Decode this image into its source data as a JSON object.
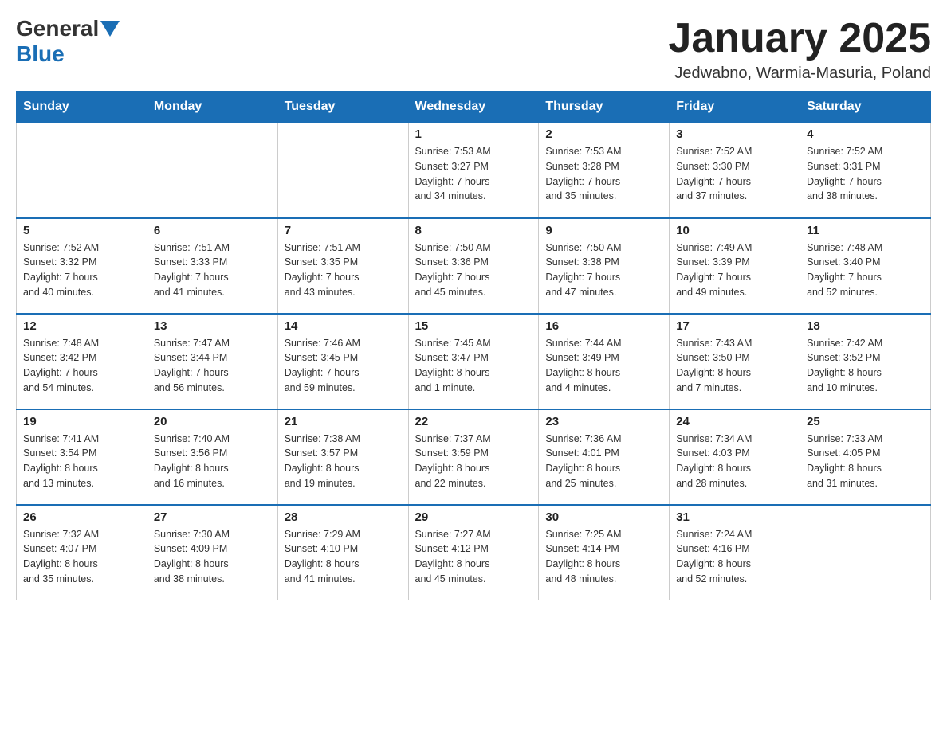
{
  "header": {
    "logo_general": "General",
    "logo_blue": "Blue",
    "month_year": "January 2025",
    "location": "Jedwabno, Warmia-Masuria, Poland"
  },
  "days_of_week": [
    "Sunday",
    "Monday",
    "Tuesday",
    "Wednesday",
    "Thursday",
    "Friday",
    "Saturday"
  ],
  "weeks": [
    [
      {
        "day": "",
        "info": ""
      },
      {
        "day": "",
        "info": ""
      },
      {
        "day": "",
        "info": ""
      },
      {
        "day": "1",
        "info": "Sunrise: 7:53 AM\nSunset: 3:27 PM\nDaylight: 7 hours\nand 34 minutes."
      },
      {
        "day": "2",
        "info": "Sunrise: 7:53 AM\nSunset: 3:28 PM\nDaylight: 7 hours\nand 35 minutes."
      },
      {
        "day": "3",
        "info": "Sunrise: 7:52 AM\nSunset: 3:30 PM\nDaylight: 7 hours\nand 37 minutes."
      },
      {
        "day": "4",
        "info": "Sunrise: 7:52 AM\nSunset: 3:31 PM\nDaylight: 7 hours\nand 38 minutes."
      }
    ],
    [
      {
        "day": "5",
        "info": "Sunrise: 7:52 AM\nSunset: 3:32 PM\nDaylight: 7 hours\nand 40 minutes."
      },
      {
        "day": "6",
        "info": "Sunrise: 7:51 AM\nSunset: 3:33 PM\nDaylight: 7 hours\nand 41 minutes."
      },
      {
        "day": "7",
        "info": "Sunrise: 7:51 AM\nSunset: 3:35 PM\nDaylight: 7 hours\nand 43 minutes."
      },
      {
        "day": "8",
        "info": "Sunrise: 7:50 AM\nSunset: 3:36 PM\nDaylight: 7 hours\nand 45 minutes."
      },
      {
        "day": "9",
        "info": "Sunrise: 7:50 AM\nSunset: 3:38 PM\nDaylight: 7 hours\nand 47 minutes."
      },
      {
        "day": "10",
        "info": "Sunrise: 7:49 AM\nSunset: 3:39 PM\nDaylight: 7 hours\nand 49 minutes."
      },
      {
        "day": "11",
        "info": "Sunrise: 7:48 AM\nSunset: 3:40 PM\nDaylight: 7 hours\nand 52 minutes."
      }
    ],
    [
      {
        "day": "12",
        "info": "Sunrise: 7:48 AM\nSunset: 3:42 PM\nDaylight: 7 hours\nand 54 minutes."
      },
      {
        "day": "13",
        "info": "Sunrise: 7:47 AM\nSunset: 3:44 PM\nDaylight: 7 hours\nand 56 minutes."
      },
      {
        "day": "14",
        "info": "Sunrise: 7:46 AM\nSunset: 3:45 PM\nDaylight: 7 hours\nand 59 minutes."
      },
      {
        "day": "15",
        "info": "Sunrise: 7:45 AM\nSunset: 3:47 PM\nDaylight: 8 hours\nand 1 minute."
      },
      {
        "day": "16",
        "info": "Sunrise: 7:44 AM\nSunset: 3:49 PM\nDaylight: 8 hours\nand 4 minutes."
      },
      {
        "day": "17",
        "info": "Sunrise: 7:43 AM\nSunset: 3:50 PM\nDaylight: 8 hours\nand 7 minutes."
      },
      {
        "day": "18",
        "info": "Sunrise: 7:42 AM\nSunset: 3:52 PM\nDaylight: 8 hours\nand 10 minutes."
      }
    ],
    [
      {
        "day": "19",
        "info": "Sunrise: 7:41 AM\nSunset: 3:54 PM\nDaylight: 8 hours\nand 13 minutes."
      },
      {
        "day": "20",
        "info": "Sunrise: 7:40 AM\nSunset: 3:56 PM\nDaylight: 8 hours\nand 16 minutes."
      },
      {
        "day": "21",
        "info": "Sunrise: 7:38 AM\nSunset: 3:57 PM\nDaylight: 8 hours\nand 19 minutes."
      },
      {
        "day": "22",
        "info": "Sunrise: 7:37 AM\nSunset: 3:59 PM\nDaylight: 8 hours\nand 22 minutes."
      },
      {
        "day": "23",
        "info": "Sunrise: 7:36 AM\nSunset: 4:01 PM\nDaylight: 8 hours\nand 25 minutes."
      },
      {
        "day": "24",
        "info": "Sunrise: 7:34 AM\nSunset: 4:03 PM\nDaylight: 8 hours\nand 28 minutes."
      },
      {
        "day": "25",
        "info": "Sunrise: 7:33 AM\nSunset: 4:05 PM\nDaylight: 8 hours\nand 31 minutes."
      }
    ],
    [
      {
        "day": "26",
        "info": "Sunrise: 7:32 AM\nSunset: 4:07 PM\nDaylight: 8 hours\nand 35 minutes."
      },
      {
        "day": "27",
        "info": "Sunrise: 7:30 AM\nSunset: 4:09 PM\nDaylight: 8 hours\nand 38 minutes."
      },
      {
        "day": "28",
        "info": "Sunrise: 7:29 AM\nSunset: 4:10 PM\nDaylight: 8 hours\nand 41 minutes."
      },
      {
        "day": "29",
        "info": "Sunrise: 7:27 AM\nSunset: 4:12 PM\nDaylight: 8 hours\nand 45 minutes."
      },
      {
        "day": "30",
        "info": "Sunrise: 7:25 AM\nSunset: 4:14 PM\nDaylight: 8 hours\nand 48 minutes."
      },
      {
        "day": "31",
        "info": "Sunrise: 7:24 AM\nSunset: 4:16 PM\nDaylight: 8 hours\nand 52 minutes."
      },
      {
        "day": "",
        "info": ""
      }
    ]
  ]
}
